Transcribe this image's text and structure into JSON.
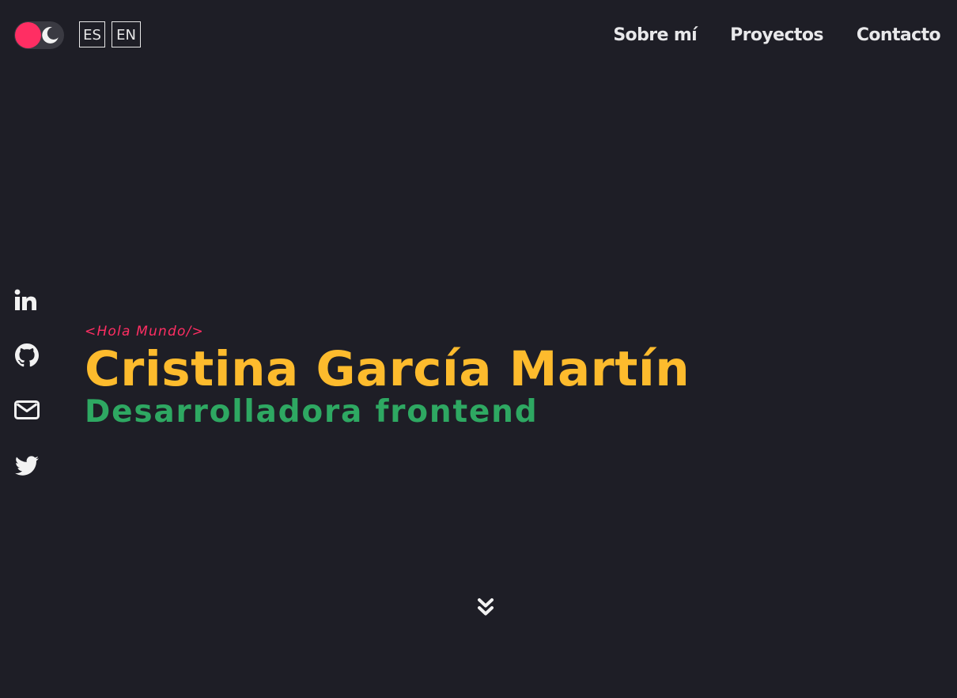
{
  "header": {
    "theme_toggle": {
      "state": "dark",
      "knob_color": "#ff2e63",
      "icon": "moon-icon"
    },
    "languages": [
      {
        "code": "ES",
        "active": true
      },
      {
        "code": "EN",
        "active": false
      }
    ],
    "nav": [
      {
        "label": "Sobre mí"
      },
      {
        "label": "Proyectos"
      },
      {
        "label": "Contacto"
      }
    ]
  },
  "social": [
    {
      "icon": "linkedin-icon"
    },
    {
      "icon": "github-icon"
    },
    {
      "icon": "mail-icon"
    },
    {
      "icon": "twitter-icon"
    }
  ],
  "hero": {
    "greeting": "<Hola Mundo/>",
    "name": "Cristina García Martín",
    "role": "Desarrolladora frontend"
  },
  "scroll_indicator": {
    "icon": "double-chevron-down-icon"
  },
  "colors": {
    "background": "#1e1e26",
    "accent_pink": "#ff2e63",
    "accent_yellow": "#fdbb2d",
    "accent_green": "#2ea862",
    "text_light": "#e8e8ea"
  }
}
